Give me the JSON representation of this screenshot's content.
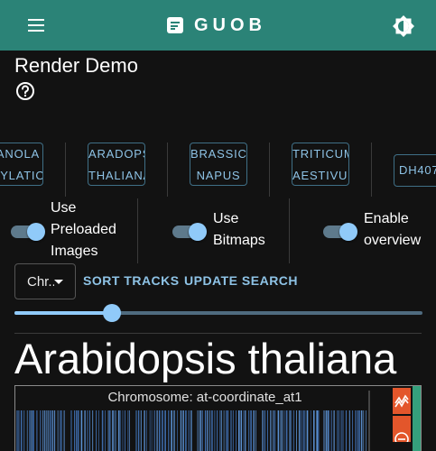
{
  "app": {
    "brand": "GUOB"
  },
  "page": {
    "title": "Render Demo"
  },
  "datasets": [
    {
      "line1": "ANOLA",
      "line2": "HYLATION"
    },
    {
      "line1": "ARADOPSIS",
      "line2": "THALIANA"
    },
    {
      "line1": "BRASSICA",
      "line2": "NAPUS"
    },
    {
      "line1": "TRITICUM",
      "line2": "AESTIVUM"
    },
    {
      "line1": "DH407",
      "line2": ""
    }
  ],
  "toggles": [
    {
      "label_line1": "Use",
      "label_line2": "Preloaded",
      "label_line3": "Images",
      "checked": true
    },
    {
      "label_line1": "Use",
      "label_line2": "Bitmaps",
      "checked": true
    },
    {
      "label_line1": "Enable",
      "label_line2": "overview",
      "checked": true
    }
  ],
  "controls": {
    "chromosome_select": "Chr...",
    "sort_tracks": "SORT TRACKS",
    "update_search": "UPDATE SEARCH",
    "zoom_fraction": 0.24
  },
  "species": {
    "title": "Arabidopsis thaliana"
  },
  "track": {
    "title": "Chromosome: at-coordinate_at1"
  },
  "colors": {
    "appbar": "#2b8377",
    "accent": "#90caf9",
    "tool_orange": "#e3562b",
    "track_green": "#35a07c",
    "track_blue": "#5a8fcf"
  }
}
